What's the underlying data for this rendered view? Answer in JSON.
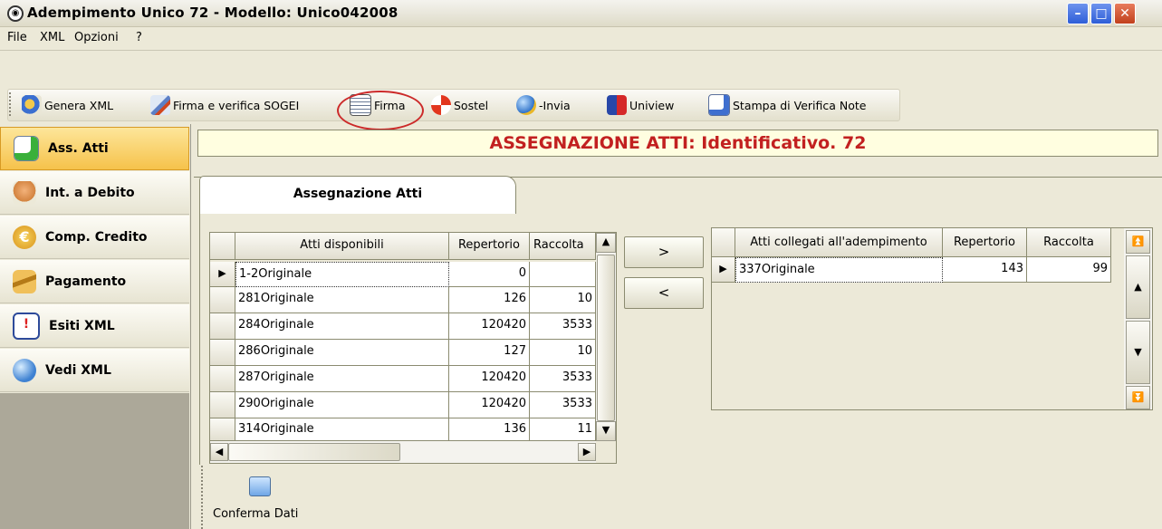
{
  "window": {
    "title": "Adempimento Unico 72 - Modello: Unico042008",
    "min_glyph": "–",
    "max_glyph": "□",
    "close_glyph": "✕"
  },
  "menu": [
    "File",
    "XML",
    "Opzioni",
    "?"
  ],
  "toolbar": [
    {
      "label": "Genera XML",
      "icon": "gears-icon"
    },
    {
      "label": "Firma e verifica SOGEI",
      "icon": "pen-icon"
    },
    {
      "label": "Firma",
      "icon": "signature-document-icon"
    },
    {
      "label": "Sostel",
      "icon": "lifebuoy-icon"
    },
    {
      "label": "-Invia",
      "icon": "globe-send-icon"
    },
    {
      "label": "Uniview",
      "icon": "uniview-icon"
    },
    {
      "label": "Stampa di Verifica Note",
      "icon": "checked-document-icon"
    }
  ],
  "sidebar": [
    {
      "label": "Ass. Atti",
      "icon": "add-document-icon",
      "active": true
    },
    {
      "label": "Int. a Debito",
      "icon": "hand-icon",
      "active": false
    },
    {
      "label": "Comp. Credito",
      "icon": "euro-coin-icon",
      "active": false
    },
    {
      "label": "Pagamento",
      "icon": "money-icon",
      "active": false
    },
    {
      "label": "Esiti XML",
      "icon": "exclamation-document-icon",
      "active": false
    },
    {
      "label": "Vedi XML",
      "icon": "globe-search-icon",
      "active": false
    }
  ],
  "banner": "ASSEGNAZIONE ATTI: Identificativo. 72",
  "tab": "Assegnazione Atti",
  "left_grid": {
    "headers": [
      "Atti disponibili",
      "Repertorio",
      "Raccolta"
    ],
    "rows": [
      [
        "1-2Originale",
        "0",
        ""
      ],
      [
        "281Originale",
        "126",
        "10"
      ],
      [
        "284Originale",
        "120420",
        "3533"
      ],
      [
        "286Originale",
        "127",
        "10"
      ],
      [
        "287Originale",
        "120420",
        "3533"
      ],
      [
        "290Originale",
        "120420",
        "3533"
      ],
      [
        "314Originale",
        "136",
        "11"
      ]
    ]
  },
  "move_buttons": {
    "add": ">",
    "remove": "<"
  },
  "right_grid": {
    "headers": [
      "Atti collegati all'adempimento",
      "Repertorio",
      "Raccolta"
    ],
    "rows": [
      [
        "337Originale",
        "143",
        "99"
      ]
    ]
  },
  "bottom": {
    "confirm_label": "Conferma Dati",
    "confirm_icon": "confirm-card-icon"
  },
  "colors": {
    "banner_text": "#c22020",
    "active_sidebar": "#f6c24b",
    "highlight_circle": "#cc2a2a"
  }
}
